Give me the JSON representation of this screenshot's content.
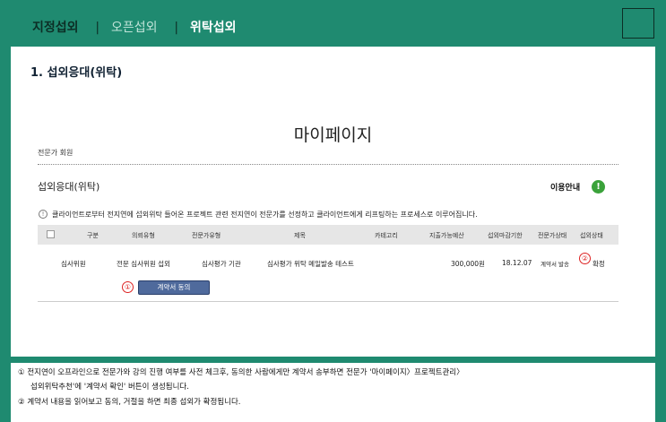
{
  "tabs": {
    "designated": "지정섭외",
    "open": "오픈섭외",
    "consigned": "위탁섭외",
    "separator": "|"
  },
  "section_title": "1. 섭외응대(위탁)",
  "page_heading": "마이페이지",
  "member_type": "전문가 회원",
  "sub_heading": "섭외응대(위탁)",
  "guide_label": "이용안내",
  "guide_icon": "!",
  "notice_icon": "!",
  "notice_text": "클라이언트로부터 전지연에 섭외위탁 들어온 프로젝트 관련 전지연이 전문가를 선정하고 클라이언트에게 리프팅하는 프로세스로 이루어집니다.",
  "table": {
    "headers": [
      "구분",
      "의뢰유형",
      "전문가유형",
      "제목",
      "카테고리",
      "지출가능예산",
      "섭외마감기한",
      "전문가상태",
      "섭외상태"
    ],
    "row": {
      "type": "심사위원",
      "request_type": "전문 심사위원 섭외",
      "expert_type": "심사평가 기관",
      "title": "심사평가 위탁 메일발송 테스트",
      "category": "",
      "budget": "300,000원",
      "deadline": "18.12.07",
      "expert_status": "계약서 발송",
      "status": "확정"
    },
    "contract_button": "계약서 동의"
  },
  "markers": {
    "one": "①",
    "two": "②"
  },
  "footer": {
    "line1": "① 전지연이 오프라인으로 전문가와 강의 진행 여부를 사전 체크후, 동의한 사람에게만 계약서 송부하면 전문가 '마이페이지〉프로젝트관리〉",
    "line2": "섭외위탁추천'에 '계약서 확인' 버튼이 생성됩니다.",
    "line3": "② 계약서 내용을 읽어보고 동의, 거절을 하면 최종 섭외가 확정됩니다."
  },
  "colors": {
    "brand": "#1f8a70",
    "button": "#4f6a9c",
    "marker": "#dd2222",
    "guide": "#3aa23a"
  }
}
